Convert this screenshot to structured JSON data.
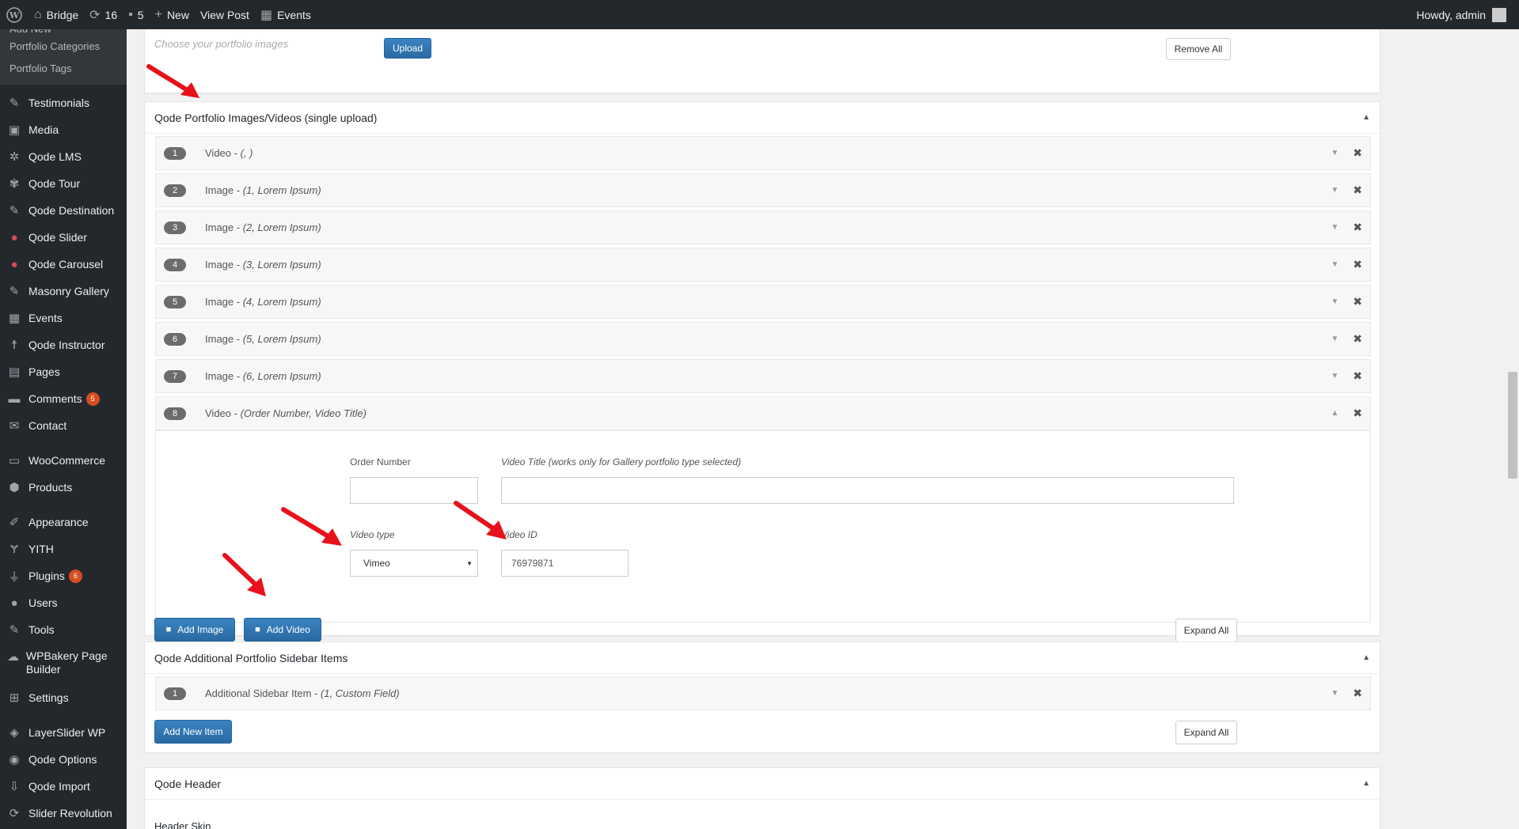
{
  "admin_bar": {
    "site_name": "Bridge",
    "updates_count": "16",
    "comments_count": "5",
    "new_label": "New",
    "view_post_label": "View Post",
    "events_label": "Events",
    "howdy_label": "Howdy, admin"
  },
  "sidebar": {
    "submenu": [
      "Add New",
      "Portfolio Categories",
      "Portfolio Tags"
    ],
    "items": [
      {
        "label": "Testimonials",
        "icon": "pin-icon"
      },
      {
        "label": "Media",
        "icon": "media-icon"
      },
      {
        "label": "Qode LMS",
        "icon": "gear-icon"
      },
      {
        "label": "Qode Tour",
        "icon": "palm-icon"
      },
      {
        "label": "Qode Destination",
        "icon": "pin-icon"
      },
      {
        "label": "Qode Slider",
        "icon": "slider-icon"
      },
      {
        "label": "Qode Carousel",
        "icon": "carousel-icon"
      },
      {
        "label": "Masonry Gallery",
        "icon": "pin-icon"
      },
      {
        "label": "Events",
        "icon": "calendar-icon"
      },
      {
        "label": "Qode Instructor",
        "icon": "person-icon"
      },
      {
        "label": "Pages",
        "icon": "pages-icon"
      },
      {
        "label": "Comments",
        "icon": "comment-icon",
        "badge": "5"
      },
      {
        "label": "Contact",
        "icon": "mail-icon"
      },
      {
        "label": "WooCommerce",
        "icon": "woo-icon"
      },
      {
        "label": "Products",
        "icon": "box-icon"
      },
      {
        "label": "Appearance",
        "icon": "brush-icon"
      },
      {
        "label": "YITH",
        "icon": "yith-icon"
      },
      {
        "label": "Plugins",
        "icon": "plug-icon",
        "badge": "6"
      },
      {
        "label": "Users",
        "icon": "user-icon"
      },
      {
        "label": "Tools",
        "icon": "wrench-icon"
      },
      {
        "label": "WPBakery Page Builder",
        "icon": "cloud-icon"
      },
      {
        "label": "Settings",
        "icon": "settings-icon"
      },
      {
        "label": "LayerSlider WP",
        "icon": "layers-icon"
      },
      {
        "label": "Qode Options",
        "icon": "qode-icon"
      },
      {
        "label": "Qode Import",
        "icon": "import-icon"
      },
      {
        "label": "Slider Revolution",
        "icon": "refresh-icon"
      }
    ]
  },
  "top_box": {
    "placeholder": "Choose your portfolio images",
    "upload_label": "Upload",
    "remove_all_label": "Remove All"
  },
  "images_box": {
    "title": "Qode Portfolio Images/Videos (single upload)",
    "rows": [
      {
        "num": "1",
        "type": "Video - ",
        "detail": "(, )"
      },
      {
        "num": "2",
        "type": "Image - ",
        "detail": "(1, Lorem Ipsum)"
      },
      {
        "num": "3",
        "type": "Image - ",
        "detail": "(2, Lorem Ipsum)"
      },
      {
        "num": "4",
        "type": "Image - ",
        "detail": "(3, Lorem Ipsum)"
      },
      {
        "num": "5",
        "type": "Image - ",
        "detail": "(4, Lorem Ipsum)"
      },
      {
        "num": "6",
        "type": "Image - ",
        "detail": "(5, Lorem Ipsum)"
      },
      {
        "num": "7",
        "type": "Image - ",
        "detail": "(6, Lorem Ipsum)"
      },
      {
        "num": "8",
        "type": "Video - ",
        "detail": "(Order Number, Video Title)"
      }
    ],
    "open_item": {
      "order_number_label": "Order Number",
      "order_number_value": "",
      "video_title_label": "Video Title (works only for Gallery portfolio type selected)",
      "video_title_value": "",
      "video_type_label": "Video type",
      "video_type_value": "Vimeo",
      "video_id_label": "Video ID",
      "video_id_value": "76979871"
    },
    "add_image_label": "Add Image",
    "add_video_label": "Add Video",
    "expand_all_label": "Expand All"
  },
  "sidebar_box": {
    "title": "Qode Additional Portfolio Sidebar Items",
    "rows": [
      {
        "num": "1",
        "type": "Additional Sidebar Item - ",
        "detail": "(1, Custom Field)"
      }
    ],
    "add_new_item_label": "Add New Item",
    "expand_all_label": "Expand All"
  },
  "header_box": {
    "title": "Qode Header",
    "field_title": "Header Skin"
  },
  "colors": {
    "admin_bar_bg": "#23282d",
    "button_blue": "#2e6da4",
    "badge_orange": "#d54e21",
    "arrow_red": "#e8111b"
  }
}
